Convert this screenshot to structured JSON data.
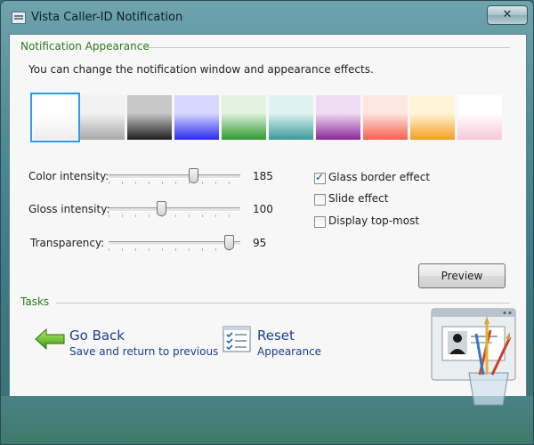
{
  "window": {
    "title": "Vista Caller-ID Notification",
    "close_label": "✕"
  },
  "appearance": {
    "group_title": "Notification Appearance",
    "description": "You can change the notification window and appearance effects.",
    "swatches": [
      {
        "name": "white",
        "top": "#ffffff",
        "bottom": "#eeeeee",
        "selected": true
      },
      {
        "name": "silver",
        "top": "#f2f2f2",
        "bottom": "#a8a8a8",
        "selected": false
      },
      {
        "name": "black",
        "top": "#c8c8c8",
        "bottom": "#1e1e1e",
        "selected": false
      },
      {
        "name": "blue",
        "top": "#d8d8ff",
        "bottom": "#2a2aee",
        "selected": false
      },
      {
        "name": "green",
        "top": "#e2f3df",
        "bottom": "#2f982f",
        "selected": false
      },
      {
        "name": "teal",
        "top": "#dff1f1",
        "bottom": "#3a9a9a",
        "selected": false
      },
      {
        "name": "purple",
        "top": "#f0dcf2",
        "bottom": "#8a2a9a",
        "selected": false
      },
      {
        "name": "salmon",
        "top": "#ffe6e0",
        "bottom": "#f56050",
        "selected": false
      },
      {
        "name": "orange",
        "top": "#fff4d8",
        "bottom": "#f5a020",
        "selected": false
      },
      {
        "name": "pink",
        "top": "#ffffff",
        "bottom": "#f8c8d8",
        "selected": false
      }
    ],
    "sliders": [
      {
        "label": "Color intensity:",
        "value": "185",
        "level": 0.64
      },
      {
        "label": "Gloss intensity:",
        "value": "100",
        "level": 0.4
      },
      {
        "label": "Transparency:",
        "value": "95",
        "level": 0.91
      }
    ],
    "options": [
      {
        "label": "Glass border effect",
        "checked": true
      },
      {
        "label": "Slide effect",
        "checked": false
      },
      {
        "label": "Display top-most",
        "checked": false
      }
    ],
    "preview_label": "Preview"
  },
  "tasks": {
    "group_title": "Tasks",
    "go_back": {
      "title": "Go Back",
      "subtitle": "Save and return to previous"
    },
    "reset": {
      "title": "Reset",
      "subtitle": "Appearance"
    }
  }
}
